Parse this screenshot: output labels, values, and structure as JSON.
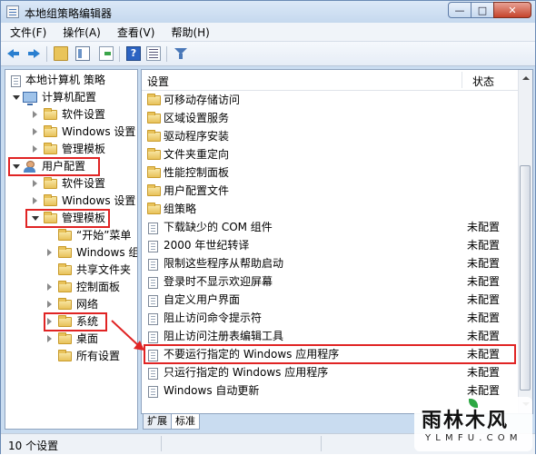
{
  "window": {
    "title": "本地组策略编辑器"
  },
  "menu": [
    "文件(F)",
    "操作(A)",
    "查看(V)",
    "帮助(H)"
  ],
  "tree": [
    {
      "label": "本地计算机 策略",
      "icon": "policy-icon",
      "expander": "none"
    },
    {
      "label": "计算机配置",
      "icon": "computer-icon",
      "expander": "open"
    },
    {
      "label": "软件设置",
      "icon": "folder-icon",
      "expander": "collapsed"
    },
    {
      "label": "Windows 设置",
      "icon": "folder-icon",
      "expander": "collapsed"
    },
    {
      "label": "管理模板",
      "icon": "folder-icon",
      "expander": "collapsed"
    },
    {
      "label": "用户配置",
      "icon": "user-icon",
      "expander": "open"
    },
    {
      "label": "软件设置",
      "icon": "folder-icon",
      "expander": "collapsed"
    },
    {
      "label": "Windows 设置",
      "icon": "folder-icon",
      "expander": "collapsed"
    },
    {
      "label": "管理模板",
      "icon": "folder-icon",
      "expander": "open"
    },
    {
      "label": "“开始”菜单",
      "icon": "folder-icon",
      "expander": "none"
    },
    {
      "label": "Windows 组件",
      "icon": "folder-icon",
      "expander": "collapsed"
    },
    {
      "label": "共享文件夹",
      "icon": "folder-icon",
      "expander": "none"
    },
    {
      "label": "控制面板",
      "icon": "folder-icon",
      "expander": "collapsed"
    },
    {
      "label": "网络",
      "icon": "folder-icon",
      "expander": "collapsed"
    },
    {
      "label": "系统",
      "icon": "folder-icon",
      "expander": "collapsed"
    },
    {
      "label": "桌面",
      "icon": "folder-icon",
      "expander": "collapsed"
    },
    {
      "label": "所有设置",
      "icon": "folder-icon",
      "expander": "none"
    }
  ],
  "list": {
    "columns": {
      "setting": "设置",
      "state": "状态"
    },
    "rows": [
      {
        "name": "可移动存储访问",
        "icon": "folder-icon",
        "state": ""
      },
      {
        "name": "区域设置服务",
        "icon": "folder-icon",
        "state": ""
      },
      {
        "name": "驱动程序安装",
        "icon": "folder-icon",
        "state": ""
      },
      {
        "name": "文件夹重定向",
        "icon": "folder-icon",
        "state": ""
      },
      {
        "name": "性能控制面板",
        "icon": "folder-icon",
        "state": ""
      },
      {
        "name": "用户配置文件",
        "icon": "folder-icon",
        "state": ""
      },
      {
        "name": "组策略",
        "icon": "folder-icon",
        "state": ""
      },
      {
        "name": "下载缺少的 COM 组件",
        "icon": "setting-icon",
        "state": "未配置"
      },
      {
        "name": "2000 年世纪转译",
        "icon": "setting-icon",
        "state": "未配置"
      },
      {
        "name": "限制这些程序从帮助启动",
        "icon": "setting-icon",
        "state": "未配置"
      },
      {
        "name": "登录时不显示欢迎屏幕",
        "icon": "setting-icon",
        "state": "未配置"
      },
      {
        "name": "自定义用户界面",
        "icon": "setting-icon",
        "state": "未配置"
      },
      {
        "name": "阻止访问命令提示符",
        "icon": "setting-icon",
        "state": "未配置"
      },
      {
        "name": "阻止访问注册表编辑工具",
        "icon": "setting-icon",
        "state": "未配置"
      },
      {
        "name": "不要运行指定的 Windows 应用程序",
        "icon": "setting-icon",
        "state": "未配置"
      },
      {
        "name": "只运行指定的 Windows 应用程序",
        "icon": "setting-icon",
        "state": "未配置"
      },
      {
        "name": "Windows 自动更新",
        "icon": "setting-icon",
        "state": "未配置"
      }
    ]
  },
  "tabs": [
    "扩展",
    "标准"
  ],
  "status": {
    "count": "10 个设置"
  },
  "watermark": {
    "main": "雨林木风",
    "sub": "Y L M F U . C O M"
  },
  "colors": {
    "highlight": "#e02424",
    "titlebar": "#c5d8ee",
    "frame": "#c9dcf0"
  }
}
